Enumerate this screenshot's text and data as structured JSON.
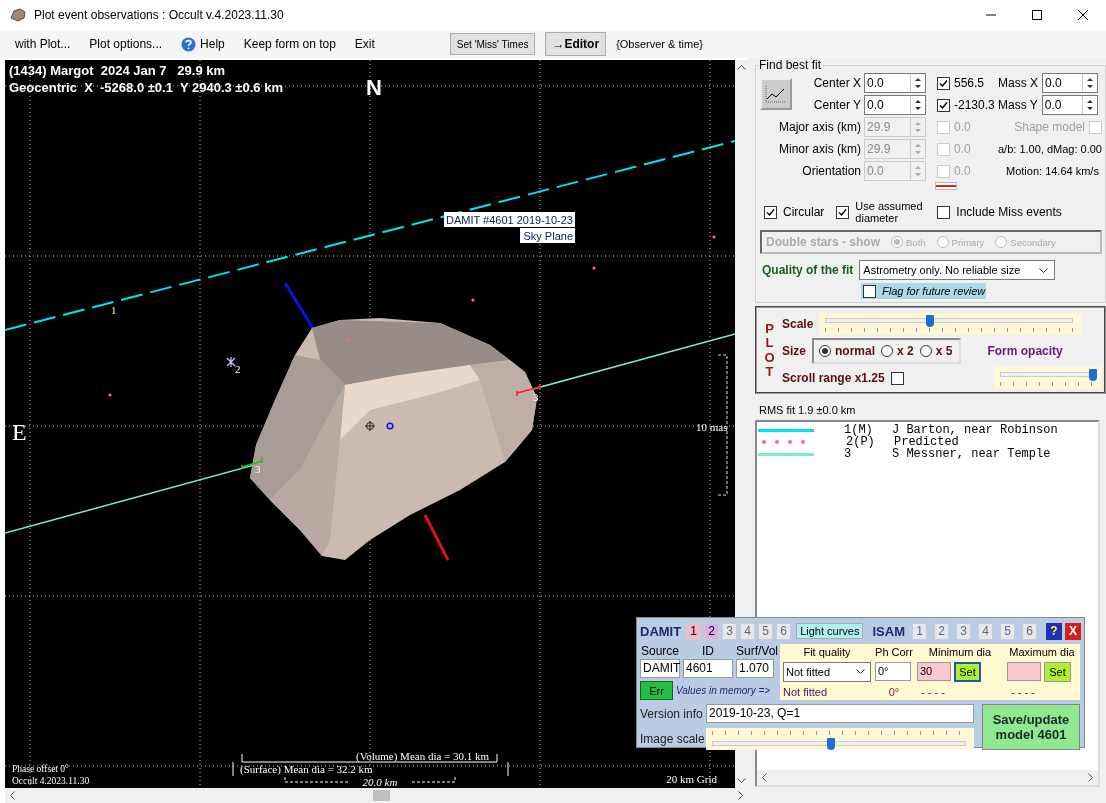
{
  "window": {
    "title": "Plot event observations : Occult v.4.2023.11.30"
  },
  "menu": [
    {
      "kind": "menu",
      "label": "with Plot..."
    },
    {
      "kind": "menu",
      "label": "Plot options..."
    },
    {
      "kind": "help",
      "label": "Help"
    },
    {
      "kind": "menu",
      "label": "Keep form on top"
    },
    {
      "kind": "menu",
      "label": "Exit"
    },
    {
      "kind": "button",
      "label": "Set 'Miss' Times"
    },
    {
      "kind": "bold-button",
      "label": "→Editor"
    },
    {
      "kind": "text",
      "label": "{Observer & time}"
    }
  ],
  "plot": {
    "title": "(1434) Margot  2024 Jan 7   29.9 km",
    "position": "Geocentric  X  -5268.0 ±0.1  Y 2940.3 ±0.6 km",
    "north": "N",
    "east": "E",
    "model_label": "DAMIT #4601 2019-10-23",
    "plane_label": "Sky Plane",
    "chord_labels": [
      "1",
      "2",
      "3",
      "3"
    ],
    "angular_scale": "10 mas",
    "volume_dia": "(Volume) Mean dia = 30.1 km",
    "surface_dia": "(Surface) Mean dia = 32.2 km",
    "scale_bar": "20.0 km",
    "phase_offset": "Phase offset 0°",
    "version": "Occult 4.2023.11.30",
    "grid": "20 km Grid"
  },
  "fit": {
    "title": "Find best fit",
    "center": [
      {
        "label": "Center X",
        "value": "0.0",
        "checked": true,
        "result": "556.5",
        "mass_label": "Mass X",
        "mass_value": "0.0"
      },
      {
        "label": "Center Y",
        "value": "0.0",
        "checked": true,
        "result": "-2130.3",
        "mass_label": "Mass Y",
        "mass_value": "0.0"
      }
    ],
    "axes": [
      {
        "label": "Major axis (km)",
        "value": "29.9",
        "checked": false,
        "result": "0.0",
        "disabled": true
      },
      {
        "label": "Minor axis (km)",
        "value": "29.9",
        "checked": false,
        "result": "0.0",
        "disabled": true
      },
      {
        "label": "Orientation",
        "value": "0.0",
        "checked": false,
        "result": "0.0",
        "disabled": true
      }
    ],
    "shape_model": {
      "label": "Shape model",
      "checked": false,
      "disabled": true
    },
    "ratio": "a/b: 1.00, dMag: 0.00",
    "motion": "Motion: 14.64 km/s",
    "options": [
      {
        "label": "Circular",
        "checked": true
      },
      {
        "label": "Use assumed diameter",
        "checked": true
      },
      {
        "label": "Include Miss events",
        "checked": false
      }
    ],
    "double_stars": {
      "label": "Double stars - show",
      "disabled": true,
      "options": [
        {
          "label": "Both",
          "selected": true
        },
        {
          "label": "Primary",
          "selected": false
        },
        {
          "label": "Secondary",
          "selected": false
        }
      ]
    },
    "quality_label": "Quality of the fit",
    "quality": "Astrometry only. No reliable size",
    "flag": {
      "label": "Flag for future review",
      "checked": false
    }
  },
  "plot_settings": {
    "title": "PLOT",
    "scale_label": "Scale",
    "scale": {
      "level": 0.42
    },
    "size_label": "Size",
    "sizes": [
      {
        "label": "normal",
        "selected": true
      },
      {
        "label": "x 2",
        "selected": false
      },
      {
        "label": "x 5",
        "selected": false
      }
    ],
    "opacity_label": "Form opacity",
    "opacity": {
      "level": 1.0
    },
    "scroll_label": "Scroll range x1.25",
    "scroll_checked": false
  },
  "rms": "RMS fit 1.9 ±0.0 km",
  "legend": [
    {
      "kind": "solid",
      "color": "#00e5e5",
      "tag": "1(M)",
      "name": "J Barton, near Robinson"
    },
    {
      "kind": "dotted",
      "color": "#ff5fb0",
      "tag": "2(P)",
      "name": "Predicted"
    },
    {
      "kind": "solid",
      "color": "#7fe8d4",
      "tag": "3",
      "name": "S Messner, near Temple"
    }
  ],
  "damit": {
    "title": "DAMIT",
    "models": [
      {
        "label": "1",
        "color": "#f5b8c4",
        "disabled": false
      },
      {
        "label": "2",
        "color": "#dcb0ea",
        "disabled": false
      },
      {
        "label": "3",
        "disabled": true
      },
      {
        "label": "4",
        "disabled": true
      },
      {
        "label": "5",
        "disabled": true
      },
      {
        "label": "6",
        "disabled": true
      }
    ],
    "light_curves": "Light curves",
    "isam_title": "ISAM",
    "isam_models": [
      {
        "label": "1",
        "disabled": true
      },
      {
        "label": "2",
        "disabled": true
      },
      {
        "label": "3",
        "disabled": true
      },
      {
        "label": "4",
        "disabled": true
      },
      {
        "label": "5",
        "disabled": true
      },
      {
        "label": "6",
        "disabled": true
      }
    ],
    "help": "?",
    "close": "X",
    "source_label": "Source",
    "id_label": "ID",
    "surf_label": "Surf/Vol",
    "source": "DAMIT",
    "id": "4601",
    "surf": "1.070",
    "err": "Err",
    "memory_label": "Values in memory =>",
    "fit_quality_label": "Fit quality",
    "fit_quality": "Not fitted",
    "ph_corr_label": "Ph Corr",
    "ph_corr": "0°",
    "min_dia_label": "Minimum dia",
    "min_dia": "30",
    "min_set": "Set",
    "max_dia_label": "Maximum dia",
    "max_set": "Set",
    "memory": {
      "fit_quality": "Not fitted",
      "ph_corr": "0°",
      "min_dia": "- - - -",
      "max_dia": "- - - -"
    },
    "version_label": "Version info",
    "version": "2019-10-23, Q=1",
    "image_scale_label": "Image scale",
    "image_scale": {
      "level": 0.47
    },
    "save": "Save/update model 4601"
  }
}
